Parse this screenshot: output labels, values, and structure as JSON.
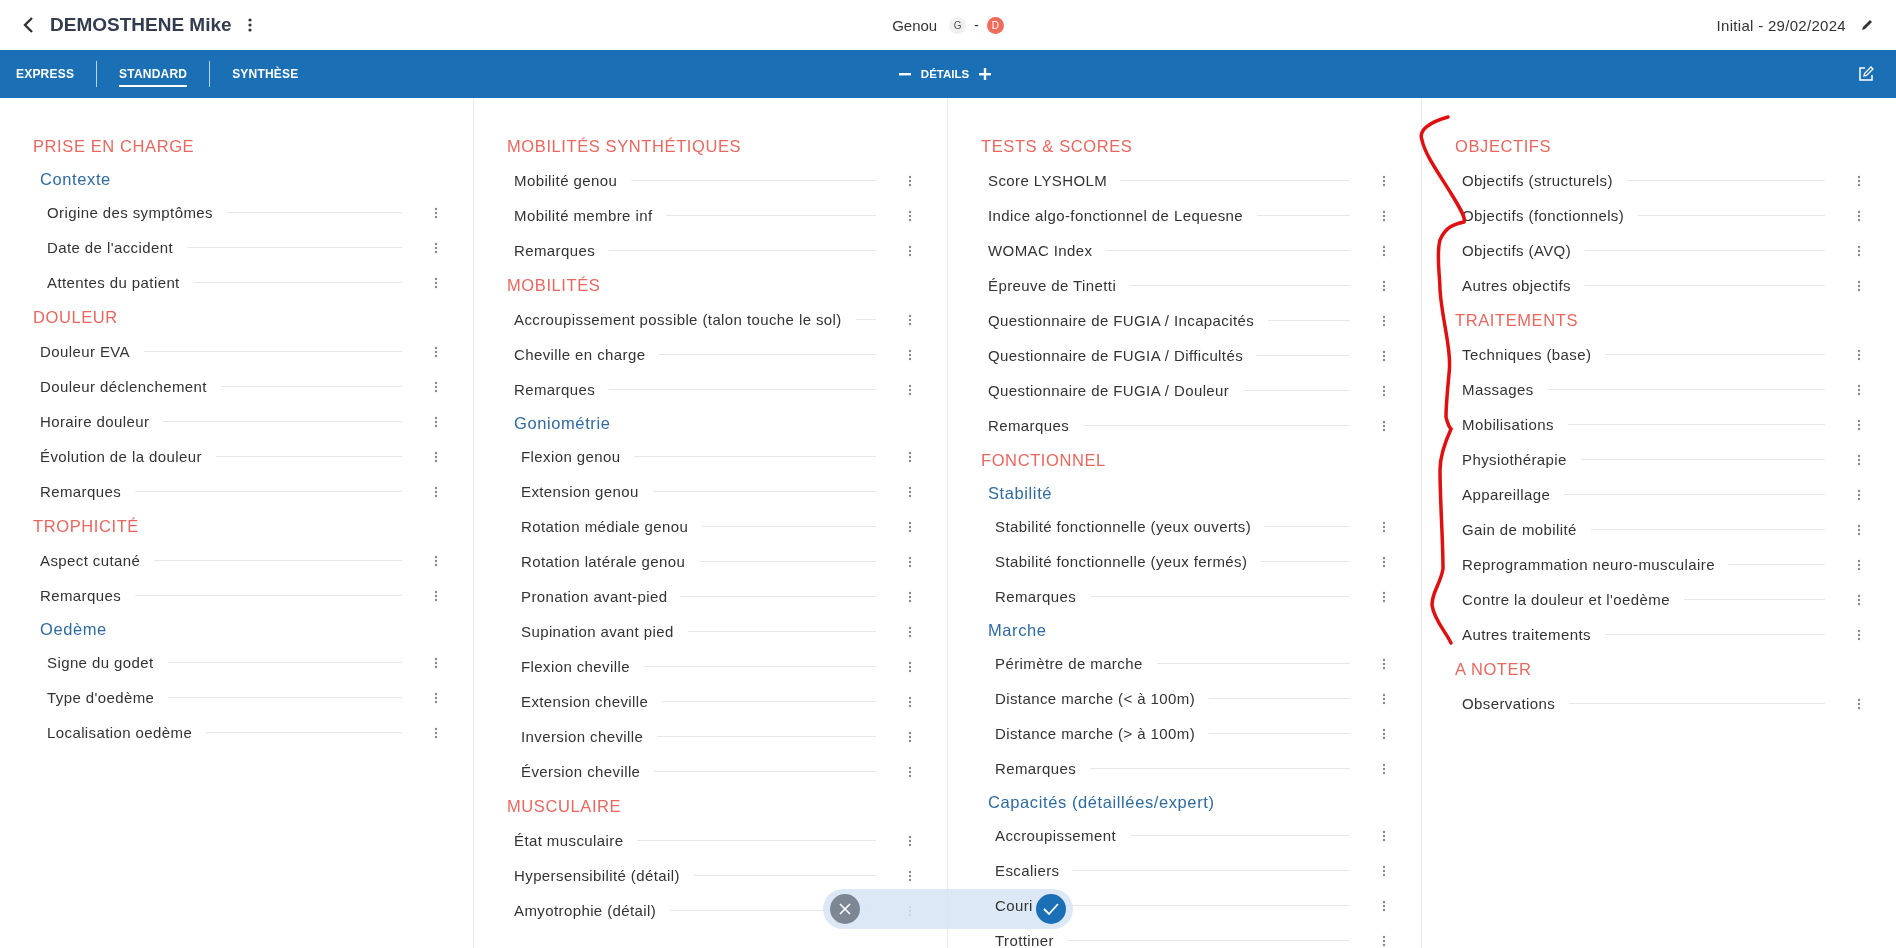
{
  "header": {
    "patient": "DEMOSTHENE Mike",
    "region": "Genou",
    "sides": [
      {
        "label": "G",
        "selected": false
      },
      {
        "label": "D",
        "selected": true
      }
    ],
    "side_separator": "-",
    "session": "Initial - 29/02/2024"
  },
  "toolbar": {
    "tabs": [
      {
        "label": "EXPRESS",
        "selected": false
      },
      {
        "label": "STANDARD",
        "selected": true
      },
      {
        "label": "SYNTHÈSE",
        "selected": false
      }
    ],
    "details": "DÉTAILS"
  },
  "columns": [
    {
      "sections": [
        {
          "title": "PRISE EN CHARGE",
          "entries": [
            {
              "kind": "group",
              "label": "Contexte",
              "children": [
                {
                  "kind": "field",
                  "label": "Origine des symptômes"
                },
                {
                  "kind": "field",
                  "label": "Date de l'accident"
                },
                {
                  "kind": "field",
                  "label": "Attentes du patient"
                }
              ]
            }
          ]
        },
        {
          "title": "DOULEUR",
          "entries": [
            {
              "kind": "field",
              "label": "Douleur EVA"
            },
            {
              "kind": "field",
              "label": "Douleur déclenchement"
            },
            {
              "kind": "field",
              "label": "Horaire douleur"
            },
            {
              "kind": "field",
              "label": "Évolution de la douleur"
            },
            {
              "kind": "field",
              "label": "Remarques"
            }
          ]
        },
        {
          "title": "TROPHICITÉ",
          "entries": [
            {
              "kind": "field",
              "label": "Aspect cutané"
            },
            {
              "kind": "field",
              "label": "Remarques"
            },
            {
              "kind": "group",
              "label": "Oedème",
              "children": [
                {
                  "kind": "field",
                  "label": "Signe du godet"
                },
                {
                  "kind": "field",
                  "label": "Type d'oedème"
                },
                {
                  "kind": "field",
                  "label": "Localisation oedème"
                }
              ]
            }
          ]
        }
      ]
    },
    {
      "sections": [
        {
          "title": "MOBILITÉS SYNTHÉTIQUES",
          "entries": [
            {
              "kind": "field",
              "label": "Mobilité genou"
            },
            {
              "kind": "field",
              "label": "Mobilité membre inf"
            },
            {
              "kind": "field",
              "label": "Remarques"
            }
          ]
        },
        {
          "title": "MOBILITÉS",
          "entries": [
            {
              "kind": "field",
              "label": "Accroupissement possible (talon touche le sol)"
            },
            {
              "kind": "field",
              "label": "Cheville en charge"
            },
            {
              "kind": "field",
              "label": "Remarques"
            },
            {
              "kind": "group",
              "label": "Goniométrie",
              "children": [
                {
                  "kind": "field",
                  "label": "Flexion genou"
                },
                {
                  "kind": "field",
                  "label": "Extension genou"
                },
                {
                  "kind": "field",
                  "label": "Rotation médiale genou"
                },
                {
                  "kind": "field",
                  "label": "Rotation latérale genou"
                },
                {
                  "kind": "field",
                  "label": "Pronation avant-pied"
                },
                {
                  "kind": "field",
                  "label": "Supination avant pied"
                },
                {
                  "kind": "field",
                  "label": "Flexion cheville"
                },
                {
                  "kind": "field",
                  "label": "Extension cheville"
                },
                {
                  "kind": "field",
                  "label": "Inversion cheville"
                },
                {
                  "kind": "field",
                  "label": "Éversion cheville"
                }
              ]
            }
          ]
        },
        {
          "title": "MUSCULAIRE",
          "entries": [
            {
              "kind": "field",
              "label": "État musculaire"
            },
            {
              "kind": "field",
              "label": "Hypersensibilité (détail)"
            },
            {
              "kind": "field",
              "label": "Amyotrophie (détail)"
            }
          ]
        }
      ]
    },
    {
      "sections": [
        {
          "title": "TESTS & SCORES",
          "entries": [
            {
              "kind": "field",
              "label": "Score LYSHOLM"
            },
            {
              "kind": "field",
              "label": "Indice algo-fonctionnel de Lequesne"
            },
            {
              "kind": "field",
              "label": "WOMAC Index"
            },
            {
              "kind": "field",
              "label": "Épreuve de Tinetti"
            },
            {
              "kind": "field",
              "label": "Questionnaire de FUGIA / Incapacités"
            },
            {
              "kind": "field",
              "label": "Questionnaire de FUGIA / Difficultés"
            },
            {
              "kind": "field",
              "label": "Questionnaire de FUGIA / Douleur"
            },
            {
              "kind": "field",
              "label": "Remarques"
            }
          ]
        },
        {
          "title": "FONCTIONNEL",
          "entries": [
            {
              "kind": "group",
              "label": "Stabilité",
              "children": [
                {
                  "kind": "field",
                  "label": "Stabilité fonctionnelle (yeux ouverts)"
                },
                {
                  "kind": "field",
                  "label": "Stabilité fonctionnelle (yeux fermés)"
                },
                {
                  "kind": "field",
                  "label": "Remarques"
                }
              ]
            },
            {
              "kind": "group",
              "label": "Marche",
              "children": [
                {
                  "kind": "field",
                  "label": "Périmètre de marche"
                },
                {
                  "kind": "field",
                  "label": "Distance marche (< à 100m)"
                },
                {
                  "kind": "field",
                  "label": "Distance marche (> à 100m)"
                },
                {
                  "kind": "field",
                  "label": "Remarques"
                }
              ]
            },
            {
              "kind": "group",
              "label": "Capacités (détaillées/expert)",
              "children": [
                {
                  "kind": "field",
                  "label": "Accroupissement"
                },
                {
                  "kind": "field",
                  "label": "Escaliers"
                },
                {
                  "kind": "field",
                  "label": "Couri"
                },
                {
                  "kind": "field",
                  "label": "Trottiner"
                }
              ]
            }
          ]
        }
      ]
    },
    {
      "sections": [
        {
          "title": "OBJECTIFS",
          "entries": [
            {
              "kind": "field",
              "label": "Objectifs (structurels)"
            },
            {
              "kind": "field",
              "label": "Objectifs (fonctionnels)"
            },
            {
              "kind": "field",
              "label": "Objectifs (AVQ)"
            },
            {
              "kind": "field",
              "label": "Autres objectifs"
            }
          ]
        },
        {
          "title": "TRAITEMENTS",
          "entries": [
            {
              "kind": "field",
              "label": "Techniques (base)"
            },
            {
              "kind": "field",
              "label": "Massages"
            },
            {
              "kind": "field",
              "label": "Mobilisations"
            },
            {
              "kind": "field",
              "label": "Physiothérapie"
            },
            {
              "kind": "field",
              "label": "Appareillage"
            },
            {
              "kind": "field",
              "label": "Gain de mobilité"
            },
            {
              "kind": "field",
              "label": "Reprogrammation neuro-musculaire"
            },
            {
              "kind": "field",
              "label": "Contre la douleur et l'oedème"
            },
            {
              "kind": "field",
              "label": "Autres traitements"
            }
          ]
        },
        {
          "title": "A NOTER",
          "entries": [
            {
              "kind": "field",
              "label": "Observations"
            }
          ]
        }
      ]
    }
  ],
  "annotation": {
    "kind": "freehand"
  }
}
